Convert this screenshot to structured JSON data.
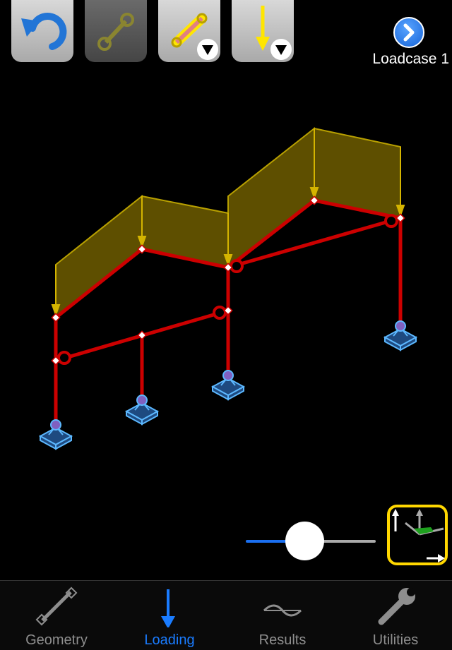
{
  "toolbar": {
    "buttons": [
      {
        "name": "undo",
        "icon": "undo-arrow-icon",
        "enabled": true
      },
      {
        "name": "add-member",
        "icon": "member-link-icon",
        "enabled": false
      },
      {
        "name": "member-load",
        "icon": "member-load-icon",
        "enabled": true,
        "has_dropdown": true
      },
      {
        "name": "point-load",
        "icon": "down-arrow-load-icon",
        "enabled": true,
        "has_dropdown": true
      }
    ]
  },
  "loadcase": {
    "label": "Loadcase 1",
    "next_icon": "chevron-right-icon"
  },
  "colors": {
    "member": "#cc0000",
    "load_fill": "#6b5a00",
    "load_edge": "#c8aa00",
    "support": "#5cb8ff",
    "accent": "#1a7cff",
    "view_border": "#ffd700"
  },
  "slider": {
    "value": 0.45
  },
  "view_control": {
    "icon": "axes-view-icon"
  },
  "tabs": [
    {
      "label": "Geometry",
      "icon": "geometry-member-icon",
      "active": false
    },
    {
      "label": "Loading",
      "icon": "loading-arrow-icon",
      "active": true
    },
    {
      "label": "Results",
      "icon": "results-wave-icon",
      "active": false
    },
    {
      "label": "Utilities",
      "icon": "wrench-icon",
      "active": false
    }
  ]
}
